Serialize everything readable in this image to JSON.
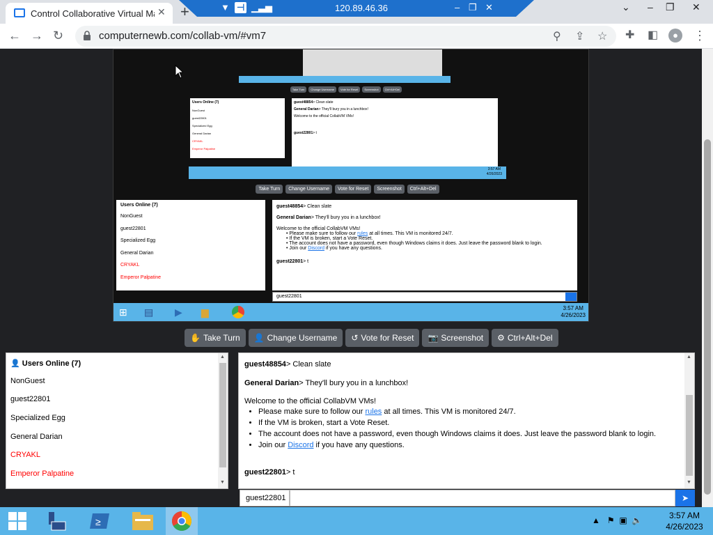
{
  "browser": {
    "tab_title": "Control Collaborative Virtual Mac",
    "rdp_ip": "120.89.46.36",
    "url": "computernewb.com/collab-vm/#vm7"
  },
  "vm": {
    "controls": {
      "take_turn": "Take Turn",
      "change_username": "Change Username",
      "vote_reset": "Vote for Reset",
      "screenshot": "Screenshot",
      "ctrl_alt_del": "Ctrl+Alt+Del"
    },
    "users_heading": "Users Online (7)",
    "users": [
      {
        "name": "NonGuest",
        "color": "#000000"
      },
      {
        "name": "guest22801",
        "color": "#000000"
      },
      {
        "name": "Specialized Egg",
        "color": "#000000"
      },
      {
        "name": "General Darian",
        "color": "#000000"
      },
      {
        "name": "CRYAKL",
        "color": "#ff0000"
      },
      {
        "name": "Emperor Palpatine",
        "color": "#ff0000"
      }
    ],
    "chat": {
      "m1_user": "guest48854",
      "m1_text": "> Clean slate",
      "m2_user": "General Darian",
      "m2_text": "> They'll bury you in a lunchbox!",
      "welcome": "Welcome to the official CollabVM VMs!",
      "rule1_pre": "Please make sure to follow our ",
      "rule1_link": "rules",
      "rule1_post": " at all times. This VM is monitored 24/7.",
      "rule2": "If the VM is broken, start a Vote Reset.",
      "rule3": "The account does not have a password, even though Windows claims it does. Just leave the password blank to login.",
      "rule4_pre": "Join our ",
      "rule4_link": "Discord",
      "rule4_post": " if you have any questions.",
      "m3_user": "guest22801",
      "m3_text": "> t"
    },
    "input_username": "guest22801"
  },
  "taskbar": {
    "time": "3:57 AM",
    "date": "4/26/2023"
  },
  "colors": {
    "taskbar": "#59b4e8",
    "page_bg": "#202124",
    "accent": "#1a73e8"
  }
}
